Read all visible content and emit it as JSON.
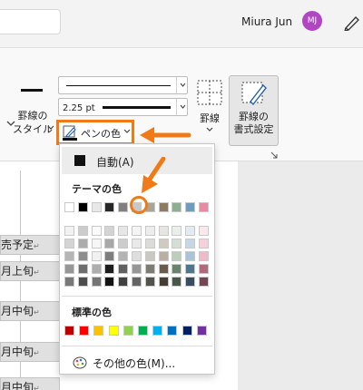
{
  "user": {
    "name": "Miura Jun",
    "initials": "MJ"
  },
  "ribbon": {
    "border_style": {
      "line1": "罫線の",
      "line2": "スタイル"
    },
    "line_weight": "2.25 pt",
    "pen_color_label": "ペンの色",
    "grid_label": "罫線",
    "border_format": {
      "line1": "罫線の",
      "line2": "書式設定"
    }
  },
  "menu": {
    "auto_label": "自動(A)",
    "theme_header": "テーマの色",
    "standard_header": "標準の色",
    "more_colors": "その他の色(M)...",
    "theme_colors": [
      "#ffffff",
      "#000000",
      "#e8e8e8",
      "#262626",
      "#808080",
      "#c8c8c8",
      "#a5a59a",
      "#8c7a63",
      "#8fae8f",
      "#6f9bbf",
      "#e98aa5"
    ],
    "standard_colors": [
      "#c00000",
      "#ff0000",
      "#ffc000",
      "#ffff00",
      "#92d050",
      "#00b050",
      "#00b0f0",
      "#0070c0",
      "#002060",
      "#7030a0"
    ]
  },
  "doc": {
    "cells": [
      "売予定",
      "月上旬",
      "月中旬",
      "月中旬",
      "月中旬"
    ],
    "return_mark": "↵"
  },
  "colors": {
    "accent": "#f07a17",
    "avatar": "#b146c2"
  }
}
